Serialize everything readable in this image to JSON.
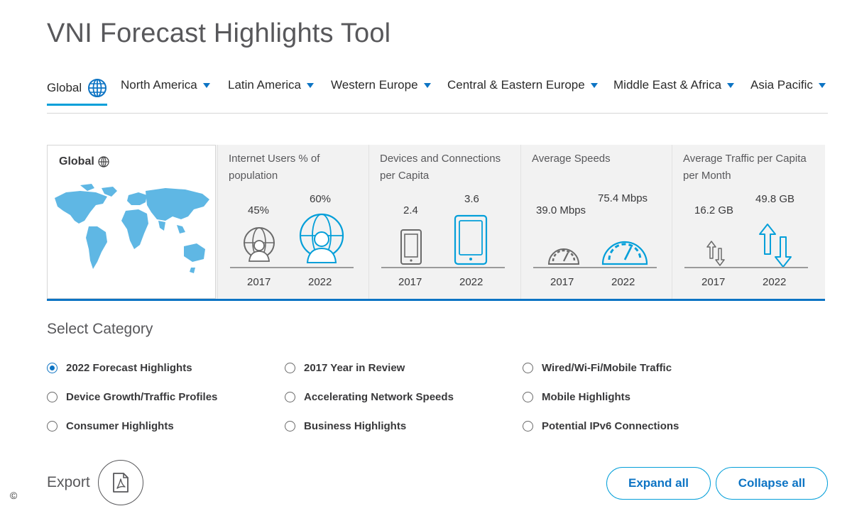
{
  "page": {
    "title": "VNI Forecast Highlights Tool"
  },
  "regions": [
    {
      "label": "Global",
      "active": true
    },
    {
      "label": "North America"
    },
    {
      "label": "Latin America"
    },
    {
      "label": "Western Europe"
    },
    {
      "label": "Central & Eastern Europe"
    },
    {
      "label": "Middle East & Africa"
    },
    {
      "label": "Asia Pacific"
    }
  ],
  "summary": {
    "region_title": "Global",
    "metrics": [
      {
        "title": "Internet Users % of population",
        "v2017": "45%",
        "v2022": "60%",
        "y1": "2017",
        "y2": "2022"
      },
      {
        "title": "Devices and Connections per Capita",
        "v2017": "2.4",
        "v2022": "3.6",
        "y1": "2017",
        "y2": "2022"
      },
      {
        "title": "Average Speeds",
        "v2017": "39.0 Mbps",
        "v2022": "75.4 Mbps",
        "y1": "2017",
        "y2": "2022"
      },
      {
        "title": "Average Traffic per Capita per Month",
        "v2017": "16.2 GB",
        "v2022": "49.8 GB",
        "y1": "2017",
        "y2": "2022"
      }
    ]
  },
  "categories": {
    "label": "Select Category",
    "selected": "2022 Forecast Highlights",
    "options": [
      "2022 Forecast Highlights",
      "2017 Year in Review",
      "Wired/Wi-Fi/Mobile Traffic",
      "Device Growth/Traffic Profiles",
      "Accelerating Network Speeds",
      "Mobile Highlights",
      "Consumer Highlights",
      "Business Highlights",
      "Potential IPv6 Connections"
    ]
  },
  "footer": {
    "export_label": "Export",
    "expand_label": "Expand all",
    "collapse_label": "Collapse all",
    "copyright": "©"
  },
  "colors": {
    "accent": "#049fd9",
    "brand_blue": "#0d74c4",
    "icon_gray": "#6a6a6a",
    "map_blue": "#5fb7e4"
  },
  "icons": [
    "globe-icon",
    "world-map",
    "person-globe-icon",
    "phone-icon",
    "tablet-icon",
    "speedometer-icon",
    "traffic-arrows-icon",
    "pdf-icon"
  ]
}
